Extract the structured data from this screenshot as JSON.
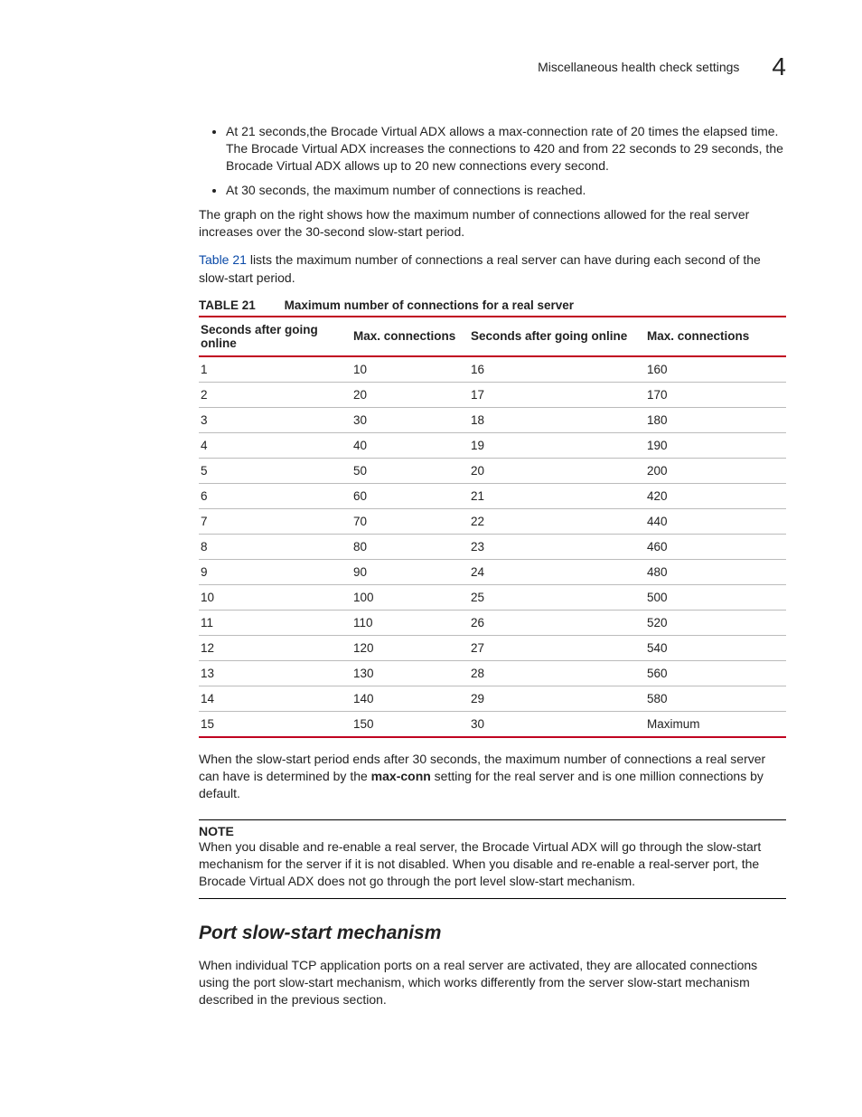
{
  "header": {
    "title": "Miscellaneous health check settings",
    "chapter": "4"
  },
  "bullets": [
    "At 21 seconds,the Brocade Virtual ADX allows a max-connection rate of 20 times the elapsed time. The Brocade Virtual ADX increases the connections to 420 and from 22 seconds to 29 seconds, the Brocade Virtual ADX allows up to 20 new connections every second.",
    "At 30 seconds, the maximum number of connections is reached."
  ],
  "para_graph": "The graph on the right shows how the maximum number of connections allowed for the real server increases over the 30-second slow-start period.",
  "para_ref_link": "Table 21",
  "para_ref_rest": " lists the maximum number of connections a real server can have during each second of the slow-start period.",
  "table": {
    "label": "TABLE 21",
    "caption": "Maximum number of connections for a real server",
    "headers": [
      "Seconds after going online",
      "Max. connections",
      "Seconds after going online",
      "Max. connections"
    ],
    "rows": [
      [
        "1",
        "10",
        "16",
        "160"
      ],
      [
        "2",
        "20",
        "17",
        "170"
      ],
      [
        "3",
        "30",
        "18",
        "180"
      ],
      [
        "4",
        "40",
        "19",
        "190"
      ],
      [
        "5",
        "50",
        "20",
        "200"
      ],
      [
        "6",
        "60",
        "21",
        "420"
      ],
      [
        "7",
        "70",
        "22",
        "440"
      ],
      [
        "8",
        "80",
        "23",
        "460"
      ],
      [
        "9",
        "90",
        "24",
        "480"
      ],
      [
        "10",
        "100",
        "25",
        "500"
      ],
      [
        "11",
        "110",
        "26",
        "520"
      ],
      [
        "12",
        "120",
        "27",
        "540"
      ],
      [
        "13",
        "130",
        "28",
        "560"
      ],
      [
        "14",
        "140",
        "29",
        "580"
      ],
      [
        "15",
        "150",
        "30",
        "Maximum"
      ]
    ]
  },
  "para_after_a": "When the slow-start period ends after 30 seconds, the maximum number of connections a real server can have is determined by the ",
  "para_after_kw": "max-conn",
  "para_after_b": " setting for the real server and is one million connections by default.",
  "note": {
    "head": "NOTE",
    "body": "When you disable and re-enable a real server, the Brocade Virtual ADX will go through the slow-start mechanism for the server if it is not disabled. When you disable and re-enable a real-server port, the Brocade Virtual ADX does not go through the port level slow-start mechanism."
  },
  "subhead": "Port slow-start mechanism",
  "subpara": "When individual TCP application ports on a real server are activated, they are allocated connections using the port slow-start mechanism, which works differently from the server slow-start mechanism described in the previous section."
}
